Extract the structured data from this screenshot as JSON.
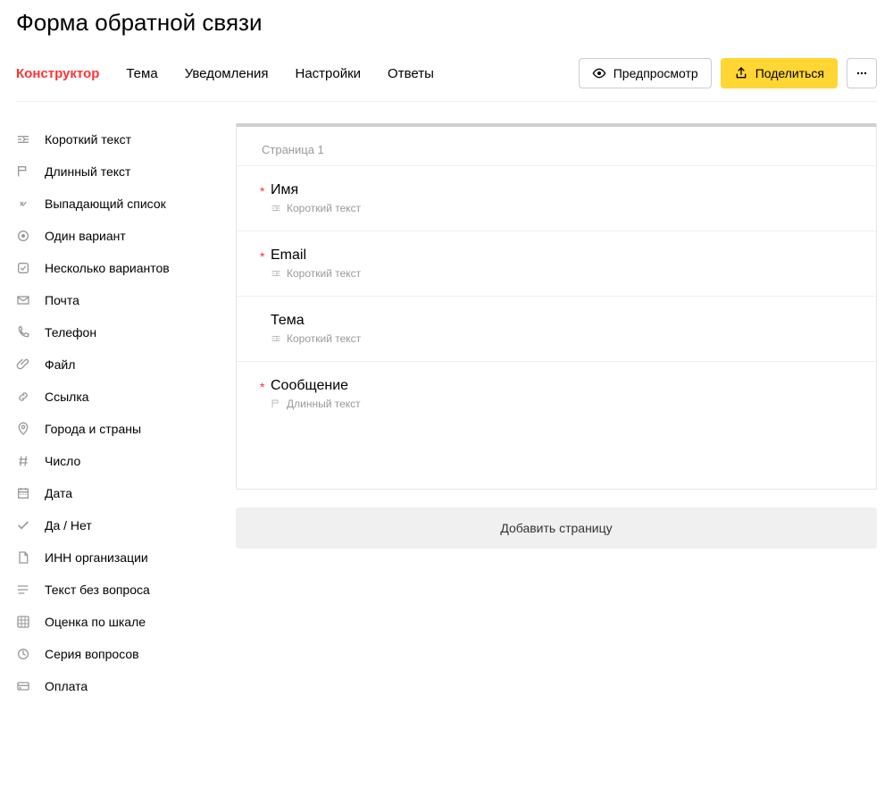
{
  "header": {
    "title": "Форма обратной связи"
  },
  "tabs": {
    "constructor": "Конструктор",
    "theme": "Тема",
    "notifications": "Уведомления",
    "settings": "Настройки",
    "answers": "Ответы"
  },
  "actions": {
    "preview": "Предпросмотр",
    "share": "Поделиться"
  },
  "sidebar": {
    "items": [
      {
        "label": "Короткий текст",
        "icon": "short-text"
      },
      {
        "label": "Длинный текст",
        "icon": "long-text"
      },
      {
        "label": "Выпадающий список",
        "icon": "dropdown"
      },
      {
        "label": "Один вариант",
        "icon": "radio"
      },
      {
        "label": "Несколько вариантов",
        "icon": "checkbox"
      },
      {
        "label": "Почта",
        "icon": "mail"
      },
      {
        "label": "Телефон",
        "icon": "phone"
      },
      {
        "label": "Файл",
        "icon": "file"
      },
      {
        "label": "Ссылка",
        "icon": "link"
      },
      {
        "label": "Города и страны",
        "icon": "location"
      },
      {
        "label": "Число",
        "icon": "hash"
      },
      {
        "label": "Дата",
        "icon": "date"
      },
      {
        "label": "Да / Нет",
        "icon": "yesno"
      },
      {
        "label": "ИНН организации",
        "icon": "inn"
      },
      {
        "label": "Текст без вопроса",
        "icon": "freetext"
      },
      {
        "label": "Оценка по шкале",
        "icon": "scale"
      },
      {
        "label": "Серия вопросов",
        "icon": "series"
      },
      {
        "label": "Оплата",
        "icon": "payment"
      }
    ]
  },
  "form": {
    "page_label": "Страница 1",
    "questions": [
      {
        "title": "Имя",
        "type_label": "Короткий текст",
        "type_icon": "short-text",
        "required": true
      },
      {
        "title": "Email",
        "type_label": "Короткий текст",
        "type_icon": "short-text",
        "required": true
      },
      {
        "title": "Тема",
        "type_label": "Короткий текст",
        "type_icon": "short-text",
        "required": false
      },
      {
        "title": "Сообщение",
        "type_label": "Длинный текст",
        "type_icon": "long-text",
        "required": true
      }
    ],
    "add_page": "Добавить страницу"
  }
}
